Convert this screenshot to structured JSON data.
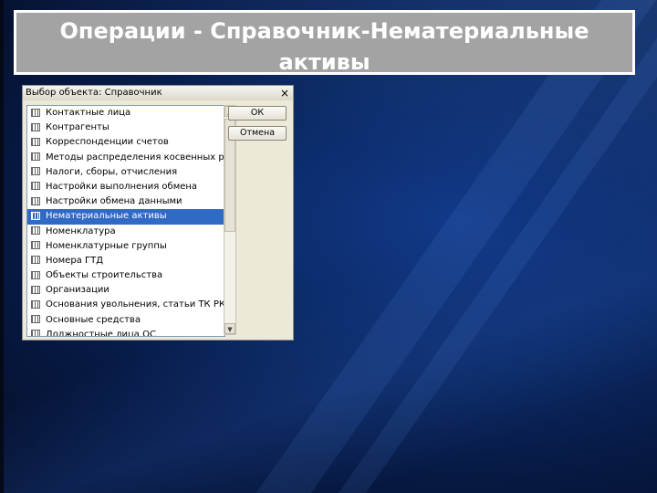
{
  "slide": {
    "title": "Операции - Справочник-Нематериальные активы"
  },
  "dialog": {
    "title": "Выбор объекта: Справочник",
    "close_glyph": "×",
    "ok_label": "ОК",
    "cancel_label": "Отмена",
    "selected_index": 7,
    "items": [
      "Контактные лица",
      "Контрагенты",
      "Корреспонденции счетов",
      "Методы распределения косвенных ра...",
      "Налоги, сборы, отчисления",
      "Настройки выполнения обмена",
      "Настройки обмена данными",
      "Нематериальные активы",
      "Номенклатура",
      "Номенклатурные группы",
      "Номера ГТД",
      "Объекты строительства",
      "Организации",
      "Основания увольнения, статьи ТК РК",
      "Основные средства",
      "Должностные лица ОС"
    ]
  },
  "colors": {
    "title_bg": "#a3a3a3",
    "selection": "#316ac5"
  }
}
